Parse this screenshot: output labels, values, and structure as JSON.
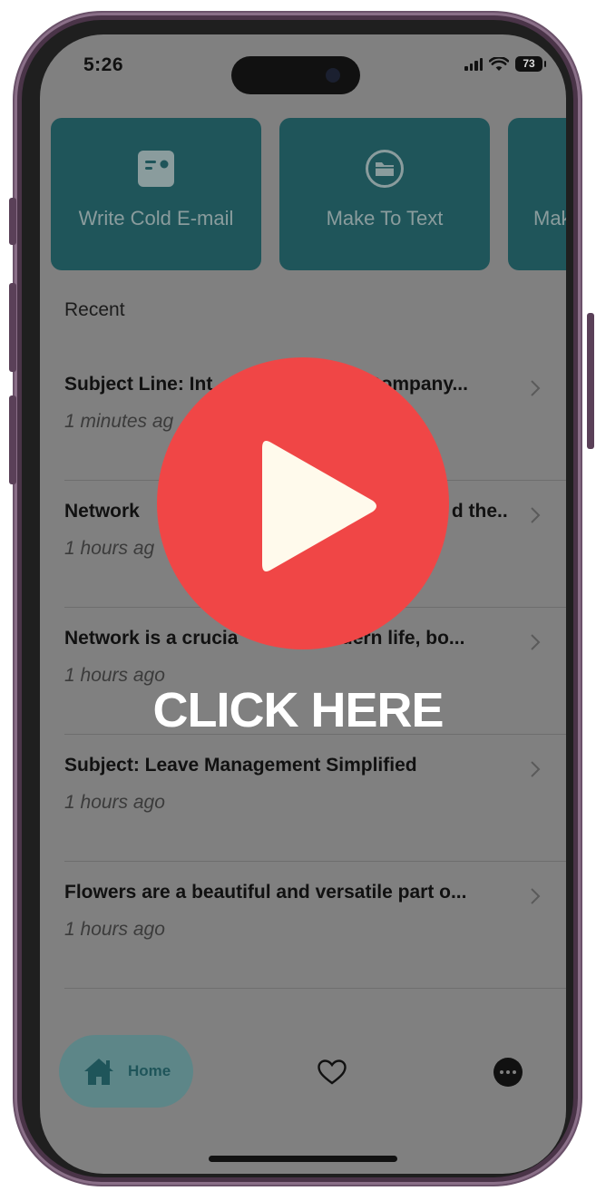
{
  "status_bar": {
    "time": "5:26",
    "battery": "73"
  },
  "action_cards": [
    {
      "label": "Write Cold E-mail",
      "icon": "card-icon"
    },
    {
      "label": "Make To Text",
      "icon": "folder-icon"
    },
    {
      "label": "Mak",
      "icon": ""
    }
  ],
  "recent": {
    "heading": "Recent",
    "items": [
      {
        "title": "Subject Line: Int",
        "title_tail": "Company...",
        "time": "1 minutes ag"
      },
      {
        "title": "Network",
        "title_tail": "d the...",
        "time": "1 hours ag"
      },
      {
        "title": "Network is a crucia",
        "title_tail": "modern life, bo...",
        "time": "1 hours ago"
      },
      {
        "title": "Subject: Leave Management Simplified",
        "title_tail": "",
        "time": "1 hours ago"
      },
      {
        "title": "Flowers are a beautiful and versatile part o...",
        "title_tail": "",
        "time": "1 hours ago"
      }
    ]
  },
  "bottom_nav": {
    "home_label": "Home",
    "favorites_icon": "heart-icon",
    "more_icon": "more-icon"
  },
  "overlay": {
    "cta": "CLICK HERE",
    "play_icon": "play-icon"
  },
  "colors": {
    "screen_dim": "#808080",
    "card_bg": "#1f555a",
    "play_red": "#f04646",
    "frame": "#4a3448"
  }
}
